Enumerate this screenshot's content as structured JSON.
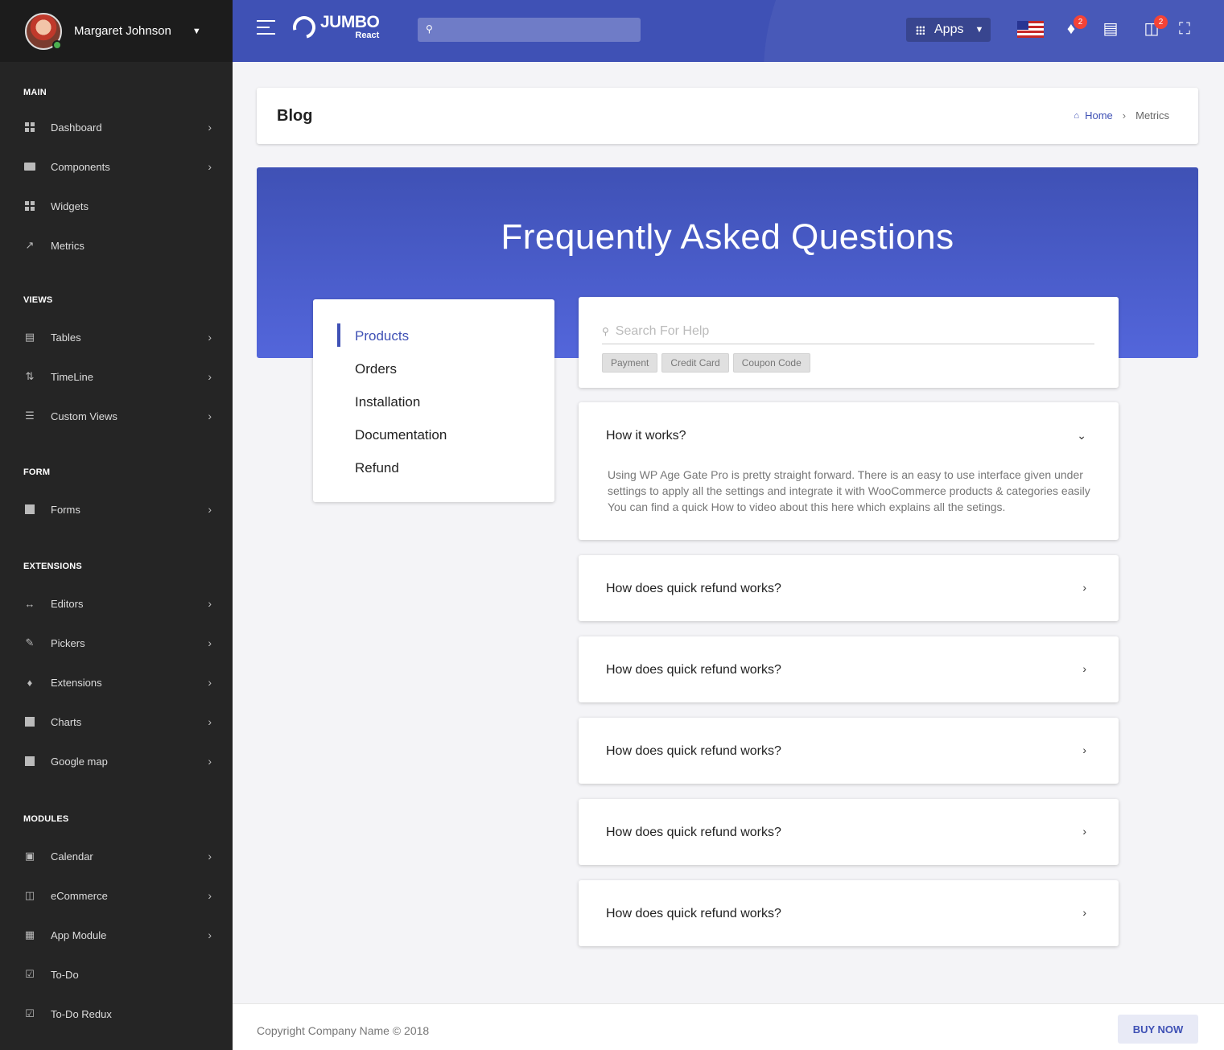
{
  "user": {
    "name": "Margaret Johnson"
  },
  "sidebar": {
    "sections": {
      "main": "MAIN",
      "views": "VIEWS",
      "form": "FORM",
      "extensions": "EXTENSIONS",
      "modules": "MODULES"
    },
    "items": [
      {
        "label": "Dashboard",
        "icon": "dashboard-icon"
      },
      {
        "label": "Components",
        "icon": "folder-icon"
      },
      {
        "label": "Widgets",
        "icon": "widgets-icon"
      },
      {
        "label": "Metrics",
        "icon": "trending-up-icon"
      },
      {
        "label": "Tables",
        "icon": "table-icon"
      },
      {
        "label": "TimeLine",
        "icon": "timeline-icon"
      },
      {
        "label": "Custom Views",
        "icon": "list-icon"
      },
      {
        "label": "Forms",
        "icon": "forms-icon"
      },
      {
        "label": "Editors",
        "icon": "code-icon"
      },
      {
        "label": "Pickers",
        "icon": "brush-icon"
      },
      {
        "label": "Extensions",
        "icon": "puzzle-icon"
      },
      {
        "label": "Charts",
        "icon": "chart-icon"
      },
      {
        "label": "Google map",
        "icon": "map-icon"
      },
      {
        "label": "Calendar",
        "icon": "calendar-icon"
      },
      {
        "label": "eCommerce",
        "icon": "cart-icon"
      },
      {
        "label": "App Module",
        "icon": "app-module-icon"
      },
      {
        "label": "To-Do",
        "icon": "checkbox-icon"
      },
      {
        "label": "To-Do Redux",
        "icon": "checkbox-icon"
      }
    ]
  },
  "header": {
    "logo_main": "JUMBO",
    "logo_sub": "React",
    "apps_label": "Apps",
    "notifications_count": "2",
    "cart_count": "2"
  },
  "page": {
    "title": "Blog",
    "breadcrumb": {
      "home": "Home",
      "current": "Metrics"
    }
  },
  "faq": {
    "heading": "Frequently Asked Questions",
    "categories": [
      "Products",
      "Orders",
      "Installation",
      "Documentation",
      "Refund"
    ],
    "active_category": "Products",
    "search_placeholder": "Search For Help",
    "tags": [
      "Payment",
      "Credit Card",
      "Coupon Code"
    ],
    "items": [
      {
        "question": "How it works?",
        "answer": "Using WP Age Gate Pro is pretty straight forward. There is an easy to use interface given under settings to apply all the settings and integrate it with WooCommerce products & categories easily You can find a quick How to video about this here which explains all the setings.",
        "expanded": true
      },
      {
        "question": "How does quick refund works?",
        "expanded": false
      },
      {
        "question": "How does quick refund works?",
        "expanded": false
      },
      {
        "question": "How does quick refund works?",
        "expanded": false
      },
      {
        "question": "How does quick refund works?",
        "expanded": false
      },
      {
        "question": "How does quick refund works?",
        "expanded": false
      }
    ]
  },
  "footer": {
    "copyright": "Copyright Company Name © 2018",
    "buy_label": "BUY NOW"
  },
  "colors": {
    "primary": "#3f51b5",
    "sidebar_bg": "#252525",
    "badge": "#f44336",
    "online": "#4caf50"
  }
}
